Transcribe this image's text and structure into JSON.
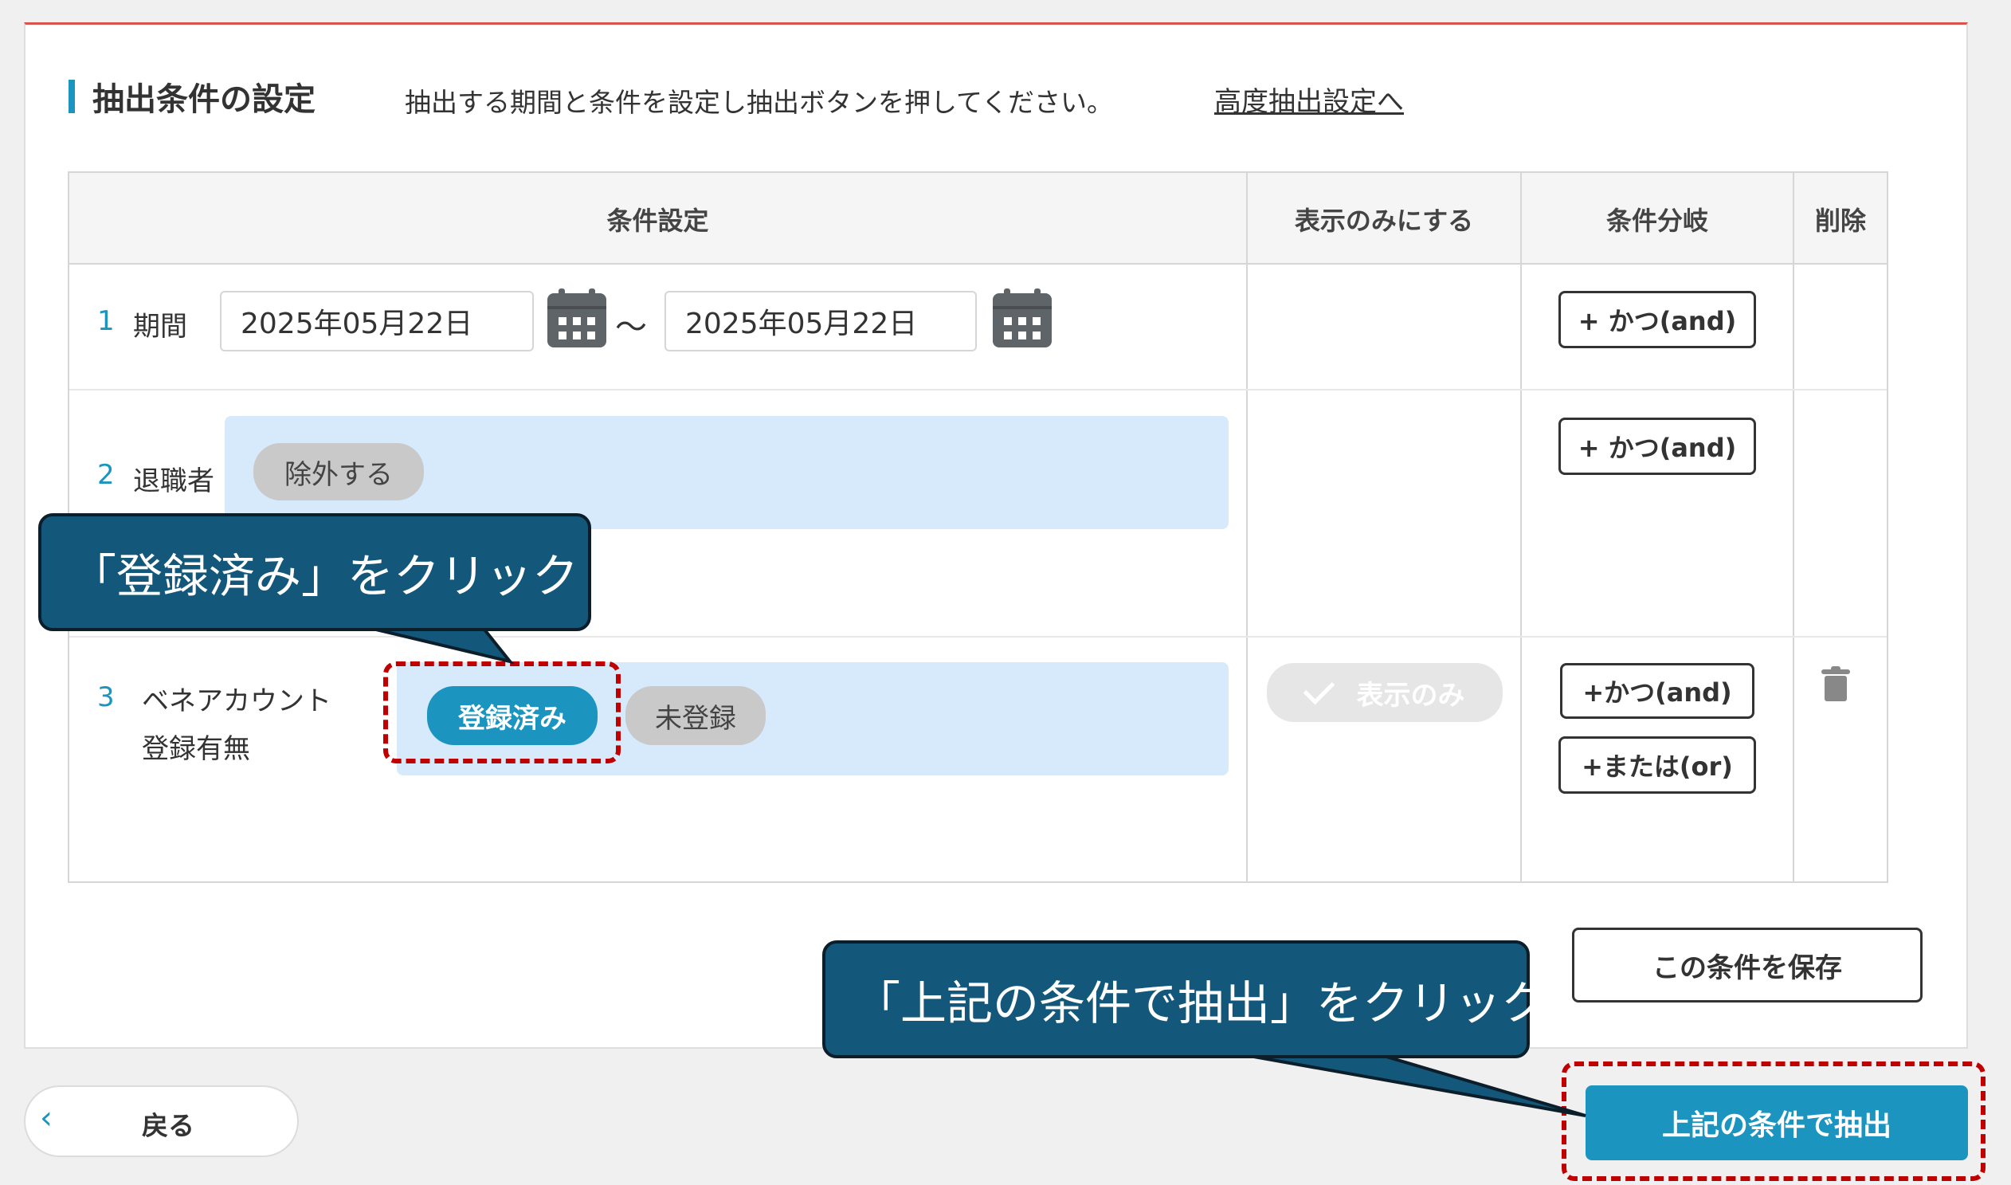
{
  "section": {
    "title": "抽出条件の設定",
    "description": "抽出する期間と条件を設定し抽出ボタンを押してください。",
    "advanced_link": "高度抽出設定へ"
  },
  "table": {
    "headers": {
      "condition": "条件設定",
      "display_only": "表示のみにする",
      "branch": "条件分岐",
      "delete": "削除"
    },
    "rows": [
      {
        "number": "1",
        "label": "期間",
        "date_from": "2025年05月22日",
        "separator": "〜",
        "date_to": "2025年05月22日",
        "and_button": "+ かつ(and)"
      },
      {
        "number": "2",
        "label": "退職者",
        "chip": "除外する",
        "and_button": "+ かつ(and)"
      },
      {
        "number": "3",
        "label_line1": "ベネアカウント",
        "label_line2": "登録有無",
        "chip_selected": "登録済み",
        "chip_other": "未登録",
        "display_only": "表示のみ",
        "and_button": "+かつ(and)",
        "or_button": "+または(or)"
      }
    ]
  },
  "buttons": {
    "save": "この条件を保存",
    "back": "戻る",
    "extract": "上記の条件で抽出"
  },
  "callouts": {
    "first": "「登録済み」をクリック",
    "second": "「上記の条件で抽出」をクリック"
  },
  "colors": {
    "accent": "#1b95c0",
    "top_border": "#d9534f",
    "callout": "#13587a",
    "highlight": "#c00000",
    "condition_bg": "#d7eafc"
  }
}
